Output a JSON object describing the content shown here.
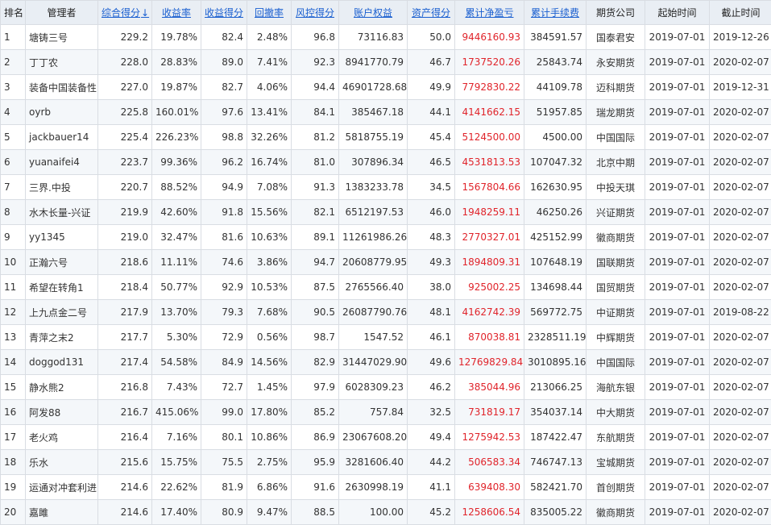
{
  "headers": [
    {
      "key": "rank",
      "label": "排名",
      "sortable": false
    },
    {
      "key": "manager",
      "label": "管理者",
      "sortable": false
    },
    {
      "key": "composite_score",
      "label": "综合得分",
      "sortable": true,
      "arrow": "↓"
    },
    {
      "key": "return_rate",
      "label": "收益率",
      "sortable": true
    },
    {
      "key": "return_score",
      "label": "收益得分",
      "sortable": true
    },
    {
      "key": "drawdown_rate",
      "label": "回撤率",
      "sortable": true
    },
    {
      "key": "risk_score",
      "label": "风控得分",
      "sortable": true
    },
    {
      "key": "equity",
      "label": "账户权益",
      "sortable": true
    },
    {
      "key": "asset_score",
      "label": "资产得分",
      "sortable": true
    },
    {
      "key": "net_pnl",
      "label": "累计净盈亏",
      "sortable": true
    },
    {
      "key": "fees",
      "label": "累计手续费",
      "sortable": true
    },
    {
      "key": "broker",
      "label": "期货公司",
      "sortable": false
    },
    {
      "key": "start",
      "label": "起始时间",
      "sortable": false
    },
    {
      "key": "end",
      "label": "截止时间",
      "sortable": false
    }
  ],
  "colors": {
    "header_bg": "#e9eef4",
    "sort_link": "#1a5fd0",
    "pnl": "#e0242b",
    "border": "#d9dde3"
  },
  "rows": [
    [
      "1",
      "塘铸三号",
      "229.2",
      "19.78%",
      "82.4",
      "2.48%",
      "96.8",
      "73116.83",
      "50.0",
      "9446160.93",
      "384591.57",
      "国泰君安",
      "2019-07-01",
      "2019-12-26"
    ],
    [
      "2",
      "丁丁农",
      "228.0",
      "28.83%",
      "89.0",
      "7.41%",
      "92.3",
      "8941770.79",
      "46.7",
      "1737520.26",
      "25843.74",
      "永安期货",
      "2019-07-01",
      "2020-02-07"
    ],
    [
      "3",
      "装备中国装备性",
      "227.0",
      "19.87%",
      "82.7",
      "4.06%",
      "94.4",
      "46901728.68",
      "49.9",
      "7792830.22",
      "44109.78",
      "迈科期货",
      "2019-07-01",
      "2019-12-31"
    ],
    [
      "4",
      "oyrb",
      "225.8",
      "160.01%",
      "97.6",
      "13.41%",
      "84.1",
      "385467.18",
      "44.1",
      "4141662.15",
      "51957.85",
      "瑞龙期货",
      "2019-07-01",
      "2020-02-07"
    ],
    [
      "5",
      "jackbauer14",
      "225.4",
      "226.23%",
      "98.8",
      "32.26%",
      "81.2",
      "5818755.19",
      "45.4",
      "5124500.00",
      "4500.00",
      "中国国际",
      "2019-07-01",
      "2020-02-07"
    ],
    [
      "6",
      "yuanaifei4",
      "223.7",
      "99.36%",
      "96.2",
      "16.74%",
      "81.0",
      "307896.34",
      "46.5",
      "4531813.53",
      "107047.32",
      "北京中期",
      "2019-07-01",
      "2020-02-07"
    ],
    [
      "7",
      "三界.中投",
      "220.7",
      "88.52%",
      "94.9",
      "7.08%",
      "91.3",
      "1383233.78",
      "34.5",
      "1567804.66",
      "162630.95",
      "中投天琪",
      "2019-07-01",
      "2020-02-07"
    ],
    [
      "8",
      "水木长量-兴证",
      "219.9",
      "42.60%",
      "91.8",
      "15.56%",
      "82.1",
      "6512197.53",
      "46.0",
      "1948259.11",
      "46250.26",
      "兴证期货",
      "2019-07-01",
      "2020-02-07"
    ],
    [
      "9",
      "yy1345",
      "219.0",
      "32.47%",
      "81.6",
      "10.63%",
      "89.1",
      "11261986.26",
      "48.3",
      "2770327.01",
      "425152.99",
      "徽商期货",
      "2019-07-01",
      "2020-02-07"
    ],
    [
      "10",
      "正瀚六号",
      "218.6",
      "11.11%",
      "74.6",
      "3.86%",
      "94.7",
      "20608779.95",
      "49.3",
      "1894809.31",
      "107648.19",
      "国联期货",
      "2019-07-01",
      "2020-02-07"
    ],
    [
      "11",
      "希望在转角1",
      "218.4",
      "50.77%",
      "92.9",
      "10.53%",
      "87.5",
      "2765566.40",
      "38.0",
      "925002.25",
      "134698.44",
      "国贸期货",
      "2019-07-01",
      "2020-02-07"
    ],
    [
      "12",
      "上九点金二号",
      "217.9",
      "13.70%",
      "79.3",
      "7.68%",
      "90.5",
      "26087790.76",
      "48.1",
      "4162742.39",
      "569772.75",
      "中证期货",
      "2019-07-01",
      "2019-08-22"
    ],
    [
      "13",
      "青萍之末2",
      "217.7",
      "5.30%",
      "72.9",
      "0.56%",
      "98.7",
      "1547.52",
      "46.1",
      "870038.81",
      "2328511.19",
      "中辉期货",
      "2019-07-01",
      "2020-02-07"
    ],
    [
      "14",
      "doggod131",
      "217.4",
      "54.58%",
      "84.9",
      "14.56%",
      "82.9",
      "31447029.90",
      "49.6",
      "12769829.84",
      "3010895.16",
      "中国国际",
      "2019-07-01",
      "2020-02-07"
    ],
    [
      "15",
      "静水熊2",
      "216.8",
      "7.43%",
      "72.7",
      "1.45%",
      "97.9",
      "6028309.23",
      "46.2",
      "385044.96",
      "213066.25",
      "海航东银",
      "2019-07-01",
      "2020-02-07"
    ],
    [
      "16",
      "阿发88",
      "216.7",
      "415.06%",
      "99.0",
      "17.80%",
      "85.2",
      "757.84",
      "32.5",
      "731819.17",
      "354037.14",
      "中大期货",
      "2019-07-01",
      "2020-02-07"
    ],
    [
      "17",
      "老火鸡",
      "216.4",
      "7.16%",
      "80.1",
      "10.86%",
      "86.9",
      "23067608.20",
      "49.4",
      "1275942.53",
      "187422.47",
      "东航期货",
      "2019-07-01",
      "2020-02-07"
    ],
    [
      "18",
      "乐水",
      "215.6",
      "15.75%",
      "75.5",
      "2.75%",
      "95.9",
      "3281606.40",
      "44.2",
      "506583.34",
      "746747.13",
      "宝城期货",
      "2019-07-01",
      "2020-02-07"
    ],
    [
      "19",
      "运通对冲套利进",
      "214.6",
      "22.62%",
      "81.9",
      "6.86%",
      "91.6",
      "2630998.19",
      "41.1",
      "639408.30",
      "582421.70",
      "首创期货",
      "2019-07-01",
      "2020-02-07"
    ],
    [
      "20",
      "嘉雎",
      "214.6",
      "17.40%",
      "80.9",
      "9.47%",
      "88.5",
      "100.00",
      "45.2",
      "1258606.54",
      "835005.22",
      "徽商期货",
      "2019-07-01",
      "2020-02-07"
    ]
  ]
}
